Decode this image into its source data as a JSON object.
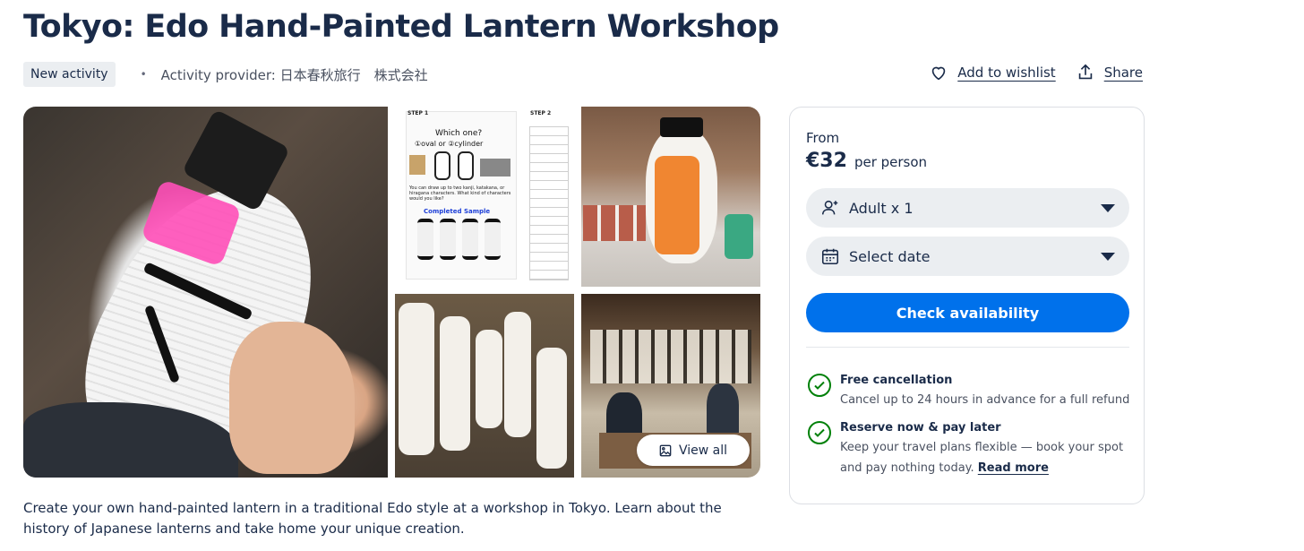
{
  "header": {
    "title": "Tokyo: Edo Hand-Painted Lantern Workshop",
    "badge": "New activity",
    "provider": "Activity provider: 日本春秋旅行　株式会社"
  },
  "actions": {
    "wishlist_label": "Add to wishlist",
    "share_label": "Share"
  },
  "gallery": {
    "view_all_label": "View all",
    "step1_image": {
      "step1": "STEP 1",
      "step2": "STEP 2",
      "question": "Which one?",
      "options": "①oval or ②cylinder",
      "hint": "You can draw up to two kanji, katakana, or hiragana characters. What kind of characters would you like?",
      "sample": "Completed Sample"
    }
  },
  "description": "Create your own hand-painted lantern in a traditional Edo style at a workshop in Tokyo. Learn about the history of Japanese lanterns and take home your unique creation.",
  "booking": {
    "from_label": "From",
    "price": "€32",
    "per_person": "per person",
    "participants": "Adult x 1",
    "date_placeholder": "Select date",
    "cta": "Check availability",
    "features": [
      {
        "title": "Free cancellation",
        "text": "Cancel up to 24 hours in advance for a full refund"
      },
      {
        "title": "Reserve now & pay later",
        "text": "Keep your travel plans flexible — book your spot and pay nothing today.",
        "link": "Read more"
      }
    ]
  },
  "colors": {
    "primary": "#0071eb",
    "text": "#1a2b49",
    "success": "#008009",
    "chip_bg": "#ebeef1"
  },
  "icons": [
    "heart-icon",
    "share-icon",
    "person-icon",
    "calendar-icon",
    "image-icon",
    "check-circle-icon"
  ]
}
